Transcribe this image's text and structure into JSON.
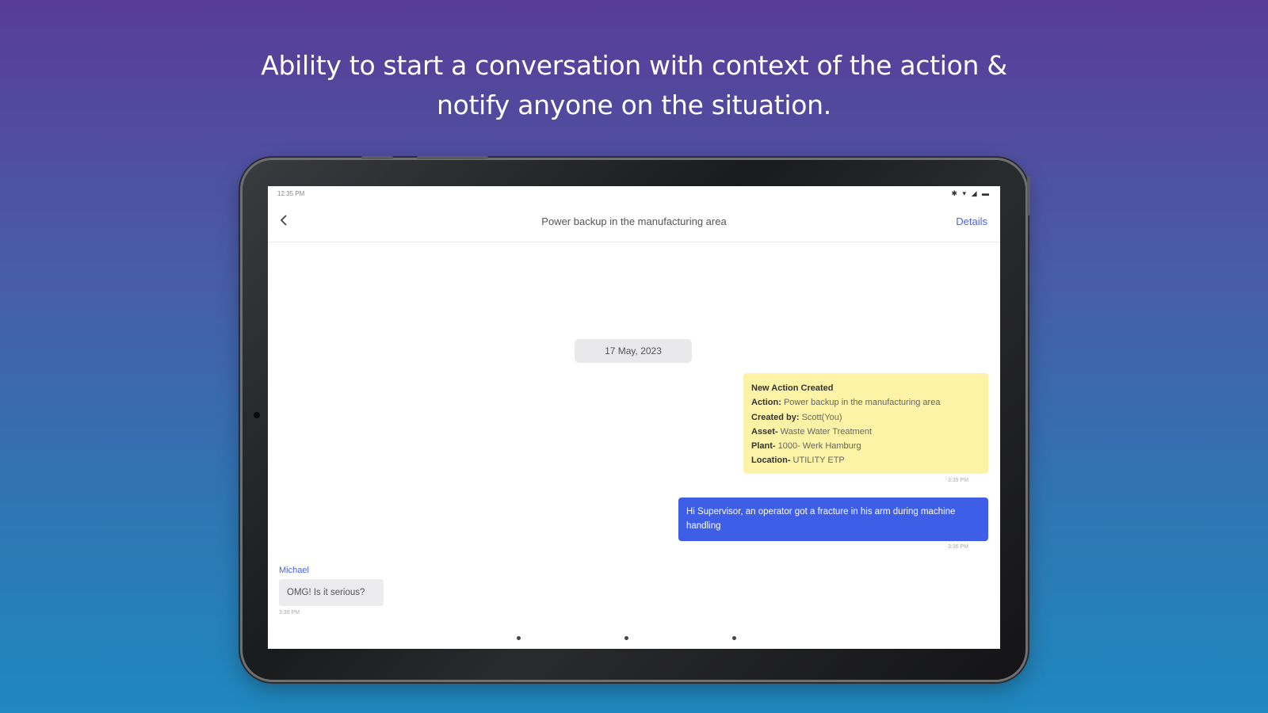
{
  "headline": {
    "line1": "Ability to start a conversation with context of the action &",
    "line2": "notify anyone on the situation."
  },
  "status_bar": {
    "time": "12:35 PM",
    "icons": "✱ ▾ ◢ ▬"
  },
  "top_bar": {
    "back_icon": "chevron-left-icon",
    "title": "Power backup in the manufacturing area",
    "details_label": "Details"
  },
  "conversation": {
    "date": "17 May, 2023",
    "action_card": {
      "heading": "New Action Created",
      "rows": [
        {
          "label": "Action:",
          "value": " Power backup in the manufacturing area"
        },
        {
          "label": "Created by:",
          "value": " Scott(You)"
        },
        {
          "label": "Asset-",
          "value": " Waste Water Treatment"
        },
        {
          "label": "Plant-",
          "value": " 1000- Werk Hamburg"
        },
        {
          "label": "Location-",
          "value": " UTILITY ETP"
        }
      ],
      "time": "3:35 PM"
    },
    "outgoing_message": {
      "text": "Hi Supervisor, an operator got a fracture in his arm during machine handling",
      "time": "3:36 PM"
    },
    "incoming_message": {
      "sender": "Michael",
      "text": "OMG! Is it serious?",
      "time": "3:36 PM"
    }
  },
  "colors": {
    "accent": "#4a63e0",
    "outgoing_bubble": "#3e5ee8",
    "action_card": "#fdf3a6",
    "incoming_bubble": "#ececee"
  }
}
